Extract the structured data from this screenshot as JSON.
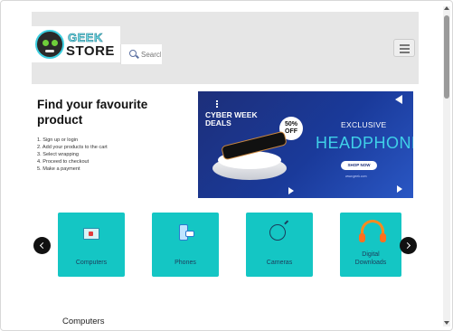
{
  "header": {
    "logo": {
      "line1": "GEEK",
      "line2": "STORE"
    },
    "search": {
      "placeholder": "Search"
    },
    "menu_icon": "hamburger-icon"
  },
  "hero": {
    "title": "Find your favourite product",
    "steps": [
      "1. Sign up or login",
      "2. Add your products to the cart",
      "3. Select wrapping",
      "4. Proceed to checkout",
      "5. Make a payment"
    ]
  },
  "banner": {
    "cyber": "CYBER WEEK",
    "deals": "DEALS",
    "discount_percent": "50%",
    "discount_off": "OFF",
    "exclusive": "EXCLUSIVE",
    "headline": "HEADPHONE",
    "cta": "SHOP NOW",
    "url": "www.geek.com"
  },
  "categories": {
    "items": [
      {
        "label": "Computers",
        "icon": "computer-icon"
      },
      {
        "label": "Phones",
        "icon": "phone-icon"
      },
      {
        "label": "Cameras",
        "icon": "camera-icon"
      },
      {
        "label": "Digital Downloads",
        "icon": "headphones-icon"
      }
    ],
    "prev_icon": "chevron-left-icon",
    "next_icon": "chevron-right-icon",
    "color": "#14c6c4"
  },
  "section": {
    "title": "Computers"
  }
}
